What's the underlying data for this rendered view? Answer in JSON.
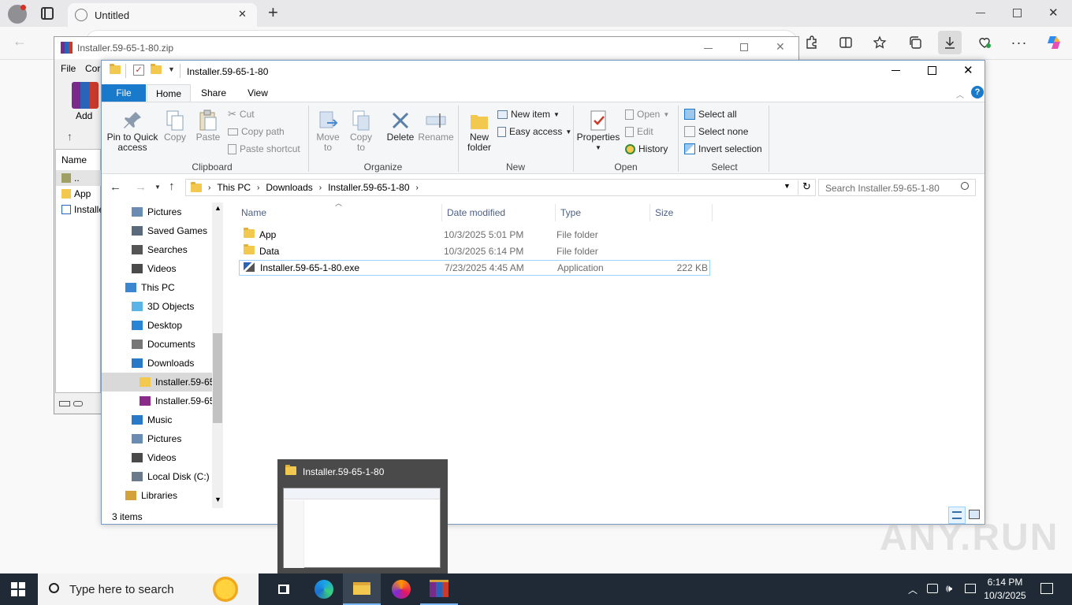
{
  "browser": {
    "tab_title": "Untitled",
    "new_tab_glyph": "+",
    "close_glyph": "✕"
  },
  "winrar": {
    "title": "Installer.59-65-1-80.zip",
    "menu_file": "File",
    "menu_commands": "Cor",
    "add_label": "Add",
    "column_name": "Name",
    "items": [
      "..",
      "App",
      "Installe"
    ]
  },
  "explorer": {
    "title": "Installer.59-65-1-80",
    "ribbon_tabs": [
      "File",
      "Home",
      "Share",
      "View"
    ],
    "clipboard": {
      "pin_line1": "Pin to Quick",
      "pin_line2": "access",
      "copy": "Copy",
      "paste": "Paste",
      "cut": "Cut",
      "copy_path": "Copy path",
      "paste_shortcut": "Paste shortcut",
      "group": "Clipboard"
    },
    "organize": {
      "move_to_1": "Move",
      "move_to_2": "to",
      "copy_to_1": "Copy",
      "copy_to_2": "to",
      "delete": "Delete",
      "rename": "Rename",
      "group": "Organize"
    },
    "new": {
      "folder_1": "New",
      "folder_2": "folder",
      "new_item": "New item",
      "easy_access": "Easy access",
      "group": "New"
    },
    "open": {
      "properties": "Properties",
      "open": "Open",
      "edit": "Edit",
      "history": "History",
      "group": "Open"
    },
    "select": {
      "select_all": "Select all",
      "select_none": "Select none",
      "invert": "Invert selection",
      "group": "Select"
    },
    "address": {
      "crumbs": [
        "This PC",
        "Downloads",
        "Installer.59-65-1-80"
      ],
      "search_placeholder": "Search Installer.59-65-1-80"
    },
    "nav": [
      {
        "label": "Pictures",
        "icon": "pictures-icon"
      },
      {
        "label": "Saved Games",
        "icon": "saved-games-icon"
      },
      {
        "label": "Searches",
        "icon": "searches-icon"
      },
      {
        "label": "Videos",
        "icon": "videos-icon"
      },
      {
        "label": "This PC",
        "icon": "this-pc-icon"
      },
      {
        "label": "3D Objects",
        "icon": "3d-objects-icon"
      },
      {
        "label": "Desktop",
        "icon": "desktop-icon"
      },
      {
        "label": "Documents",
        "icon": "documents-icon"
      },
      {
        "label": "Downloads",
        "icon": "downloads-icon"
      },
      {
        "label": "Installer.59-65",
        "icon": "folder-icon"
      },
      {
        "label": "Installer.59-65",
        "icon": "winrar-archive-icon"
      },
      {
        "label": "Music",
        "icon": "music-icon"
      },
      {
        "label": "Pictures",
        "icon": "pictures-icon"
      },
      {
        "label": "Videos",
        "icon": "videos-icon"
      },
      {
        "label": "Local Disk (C:)",
        "icon": "local-disk-icon"
      },
      {
        "label": "Libraries",
        "icon": "libraries-icon"
      }
    ],
    "columns": {
      "name": "Name",
      "date": "Date modified",
      "type": "Type",
      "size": "Size"
    },
    "files": [
      {
        "name": "App",
        "date": "10/3/2025 5:01 PM",
        "type": "File folder",
        "size": ""
      },
      {
        "name": "Data",
        "date": "10/3/2025 6:14 PM",
        "type": "File folder",
        "size": ""
      },
      {
        "name": "Installer.59-65-1-80.exe",
        "date": "7/23/2025 4:45 AM",
        "type": "Application",
        "size": "222 KB"
      }
    ],
    "status": "3 items"
  },
  "thumbnail": {
    "title": "Installer.59-65-1-80"
  },
  "watermark": "ANY.RUN",
  "taskbar": {
    "search_placeholder": "Type here to search",
    "time": "6:14 PM",
    "date": "10/3/2025"
  },
  "colors": {
    "accent": "#1979ca",
    "taskbar": "#1f2a36",
    "selection": "#cce8ff",
    "folder": "#f3c84e"
  }
}
